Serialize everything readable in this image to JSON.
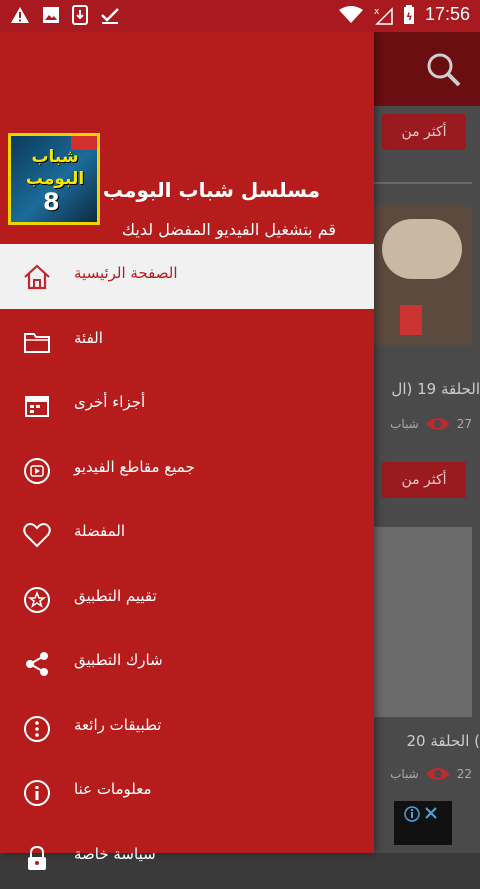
{
  "status_bar": {
    "time": "17:56",
    "left_icons": [
      "warning-icon",
      "image-icon",
      "download-icon",
      "check-icon"
    ],
    "right_icons": [
      "wifi-icon",
      "no-signal-icon",
      "battery-icon"
    ]
  },
  "drawer": {
    "app_title": "مسلسل شباب البومب",
    "subtitle": "قم بتشغيل الفيديو المفضل لديك",
    "logo": {
      "text": "شباب البومب",
      "number": "8"
    },
    "items": [
      {
        "label": "الصفحة الرئيسية",
        "icon": "home-icon",
        "active": true
      },
      {
        "label": "الفئة",
        "icon": "folder-icon",
        "active": false
      },
      {
        "label": "أجزاء أخرى",
        "icon": "calendar-icon",
        "active": false
      },
      {
        "label": "جميع مقاطع الفيديو",
        "icon": "play-video-icon",
        "active": false
      },
      {
        "label": "المفضلة",
        "icon": "heart-icon",
        "active": false
      },
      {
        "label": "تقييم التطبيق",
        "icon": "star-icon",
        "active": false
      },
      {
        "label": "شارك التطبيق",
        "icon": "share-icon",
        "active": false
      },
      {
        "label": "تطبيقات رائعة",
        "icon": "more-dots-icon",
        "active": false
      },
      {
        "label": "معلومات عنا",
        "icon": "info-icon",
        "active": false
      },
      {
        "label": "سياسة خاصة",
        "icon": "lock-icon",
        "active": false
      }
    ]
  },
  "background": {
    "more_label": "أكثر من",
    "episode_1": "الحلقة 19 (ال",
    "episode_2": "الحلقة 20 (",
    "views_1": "27",
    "views_2": "22",
    "channel": "شباب"
  },
  "colors": {
    "primary": "#b71c1c",
    "status_bar": "#a81a1f",
    "active_bg": "#f1f1f1"
  }
}
